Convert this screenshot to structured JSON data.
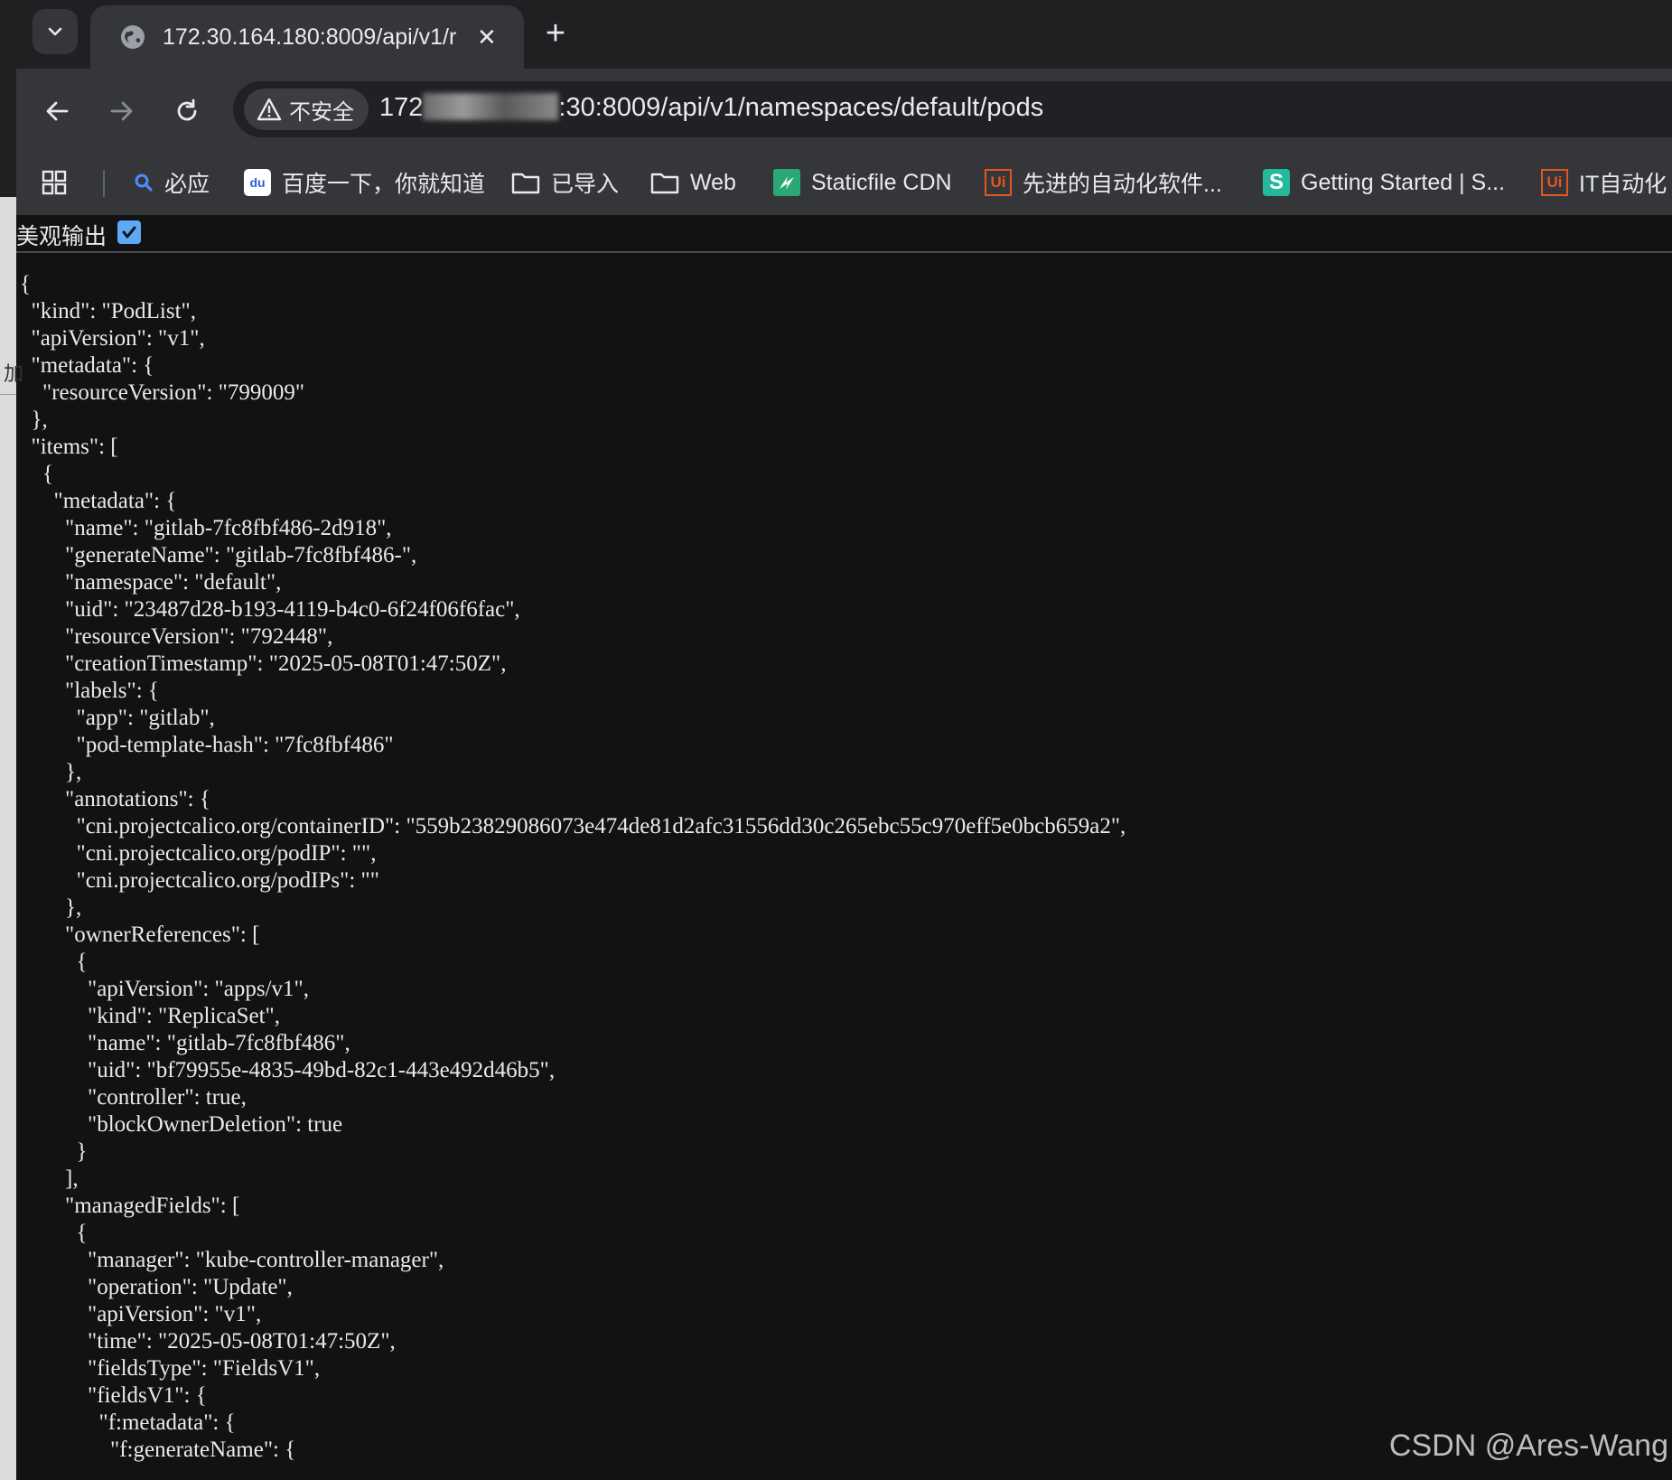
{
  "tab": {
    "title": "172.30.164.180:8009/api/v1/r"
  },
  "address": {
    "security_label": "不安全",
    "url_prefix": "172",
    "url_suffix": ":30:8009/api/v1/namespaces/default/pods"
  },
  "bookmarks": [
    {
      "label": "必应",
      "icon": "search-icon"
    },
    {
      "label": "百度一下，你就知道",
      "icon": "baidu-icon"
    },
    {
      "label": "已导入",
      "icon": "folder-icon"
    },
    {
      "label": "Web",
      "icon": "folder-icon"
    },
    {
      "label": "Staticfile CDN",
      "icon": "staticfile-icon"
    },
    {
      "label": "先进的自动化软件...",
      "icon": "uipath-icon"
    },
    {
      "label": "Getting Started | S...",
      "icon": "s-icon"
    },
    {
      "label": "IT自动化",
      "icon": "uipath-icon"
    }
  ],
  "pretty_print": {
    "label": "美观输出",
    "checked": true
  },
  "json_lines": [
    "{",
    "  \"kind\": \"PodList\",",
    "  \"apiVersion\": \"v1\",",
    "  \"metadata\": {",
    "    \"resourceVersion\": \"799009\"",
    "  },",
    "  \"items\": [",
    "    {",
    "      \"metadata\": {",
    "        \"name\": \"gitlab-7fc8fbf486-2d918\",",
    "        \"generateName\": \"gitlab-7fc8fbf486-\",",
    "        \"namespace\": \"default\",",
    "        \"uid\": \"23487d28-b193-4119-b4c0-6f24f06f6fac\",",
    "        \"resourceVersion\": \"792448\",",
    "        \"creationTimestamp\": \"2025-05-08T01:47:50Z\",",
    "        \"labels\": {",
    "          \"app\": \"gitlab\",",
    "          \"pod-template-hash\": \"7fc8fbf486\"",
    "        },",
    "        \"annotations\": {",
    "          \"cni.projectcalico.org/containerID\": \"559b23829086073e474de81d2afc31556dd30c265ebc55c970eff5e0bcb659a2\",",
    "          \"cni.projectcalico.org/podIP\": \"\",",
    "          \"cni.projectcalico.org/podIPs\": \"\"",
    "        },",
    "        \"ownerReferences\": [",
    "          {",
    "            \"apiVersion\": \"apps/v1\",",
    "            \"kind\": \"ReplicaSet\",",
    "            \"name\": \"gitlab-7fc8fbf486\",",
    "            \"uid\": \"bf79955e-4835-49bd-82c1-443e492d46b5\",",
    "            \"controller\": true,",
    "            \"blockOwnerDeletion\": true",
    "          }",
    "        ],",
    "        \"managedFields\": [",
    "          {",
    "            \"manager\": \"kube-controller-manager\",",
    "            \"operation\": \"Update\",",
    "            \"apiVersion\": \"v1\",",
    "            \"time\": \"2025-05-08T01:47:50Z\",",
    "            \"fieldsType\": \"FieldsV1\",",
    "            \"fieldsV1\": {",
    "              \"f:metadata\": {",
    "                \"f:generateName\": {"
  ],
  "left_fragment": "加",
  "watermark": "CSDN @Ares-Wang"
}
